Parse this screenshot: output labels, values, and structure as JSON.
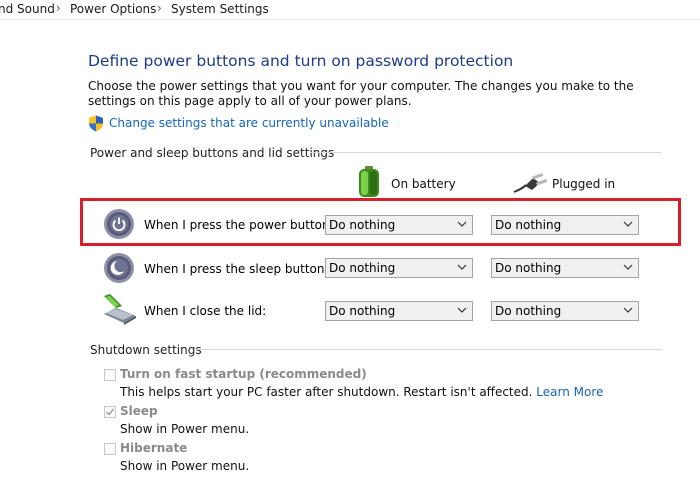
{
  "breadcrumb": {
    "items": [
      "nd Sound",
      "Power Options",
      "System Settings"
    ]
  },
  "header": {
    "title": "Define power buttons and turn on password protection",
    "description": "Choose the power settings that you want for your computer. The changes you make to the settings on this page apply to all of your power plans.",
    "change_link": "Change settings that are currently unavailable"
  },
  "power_section": {
    "label": "Power and sleep buttons and lid settings",
    "col_battery": "On battery",
    "col_plugged": "Plugged in",
    "rows": [
      {
        "label": "When I press the power button:",
        "battery": "Do nothing",
        "plugged": "Do nothing"
      },
      {
        "label": "When I press the sleep button:",
        "battery": "Do nothing",
        "plugged": "Do nothing"
      },
      {
        "label": "When I close the lid:",
        "battery": "Do nothing",
        "plugged": "Do nothing"
      }
    ]
  },
  "shutdown_section": {
    "label": "Shutdown settings",
    "items": [
      {
        "label": "Turn on fast startup (recommended)",
        "desc": "This helps start your PC faster after shutdown. Restart isn't affected.",
        "link": "Learn More",
        "checked": false
      },
      {
        "label": "Sleep",
        "desc": "Show in Power menu.",
        "checked": true
      },
      {
        "label": "Hibernate",
        "desc": "Show in Power menu.",
        "checked": false
      }
    ]
  },
  "colors": {
    "title": "#1e3b87",
    "link": "#1565b5",
    "highlight": "#d61f2a"
  }
}
